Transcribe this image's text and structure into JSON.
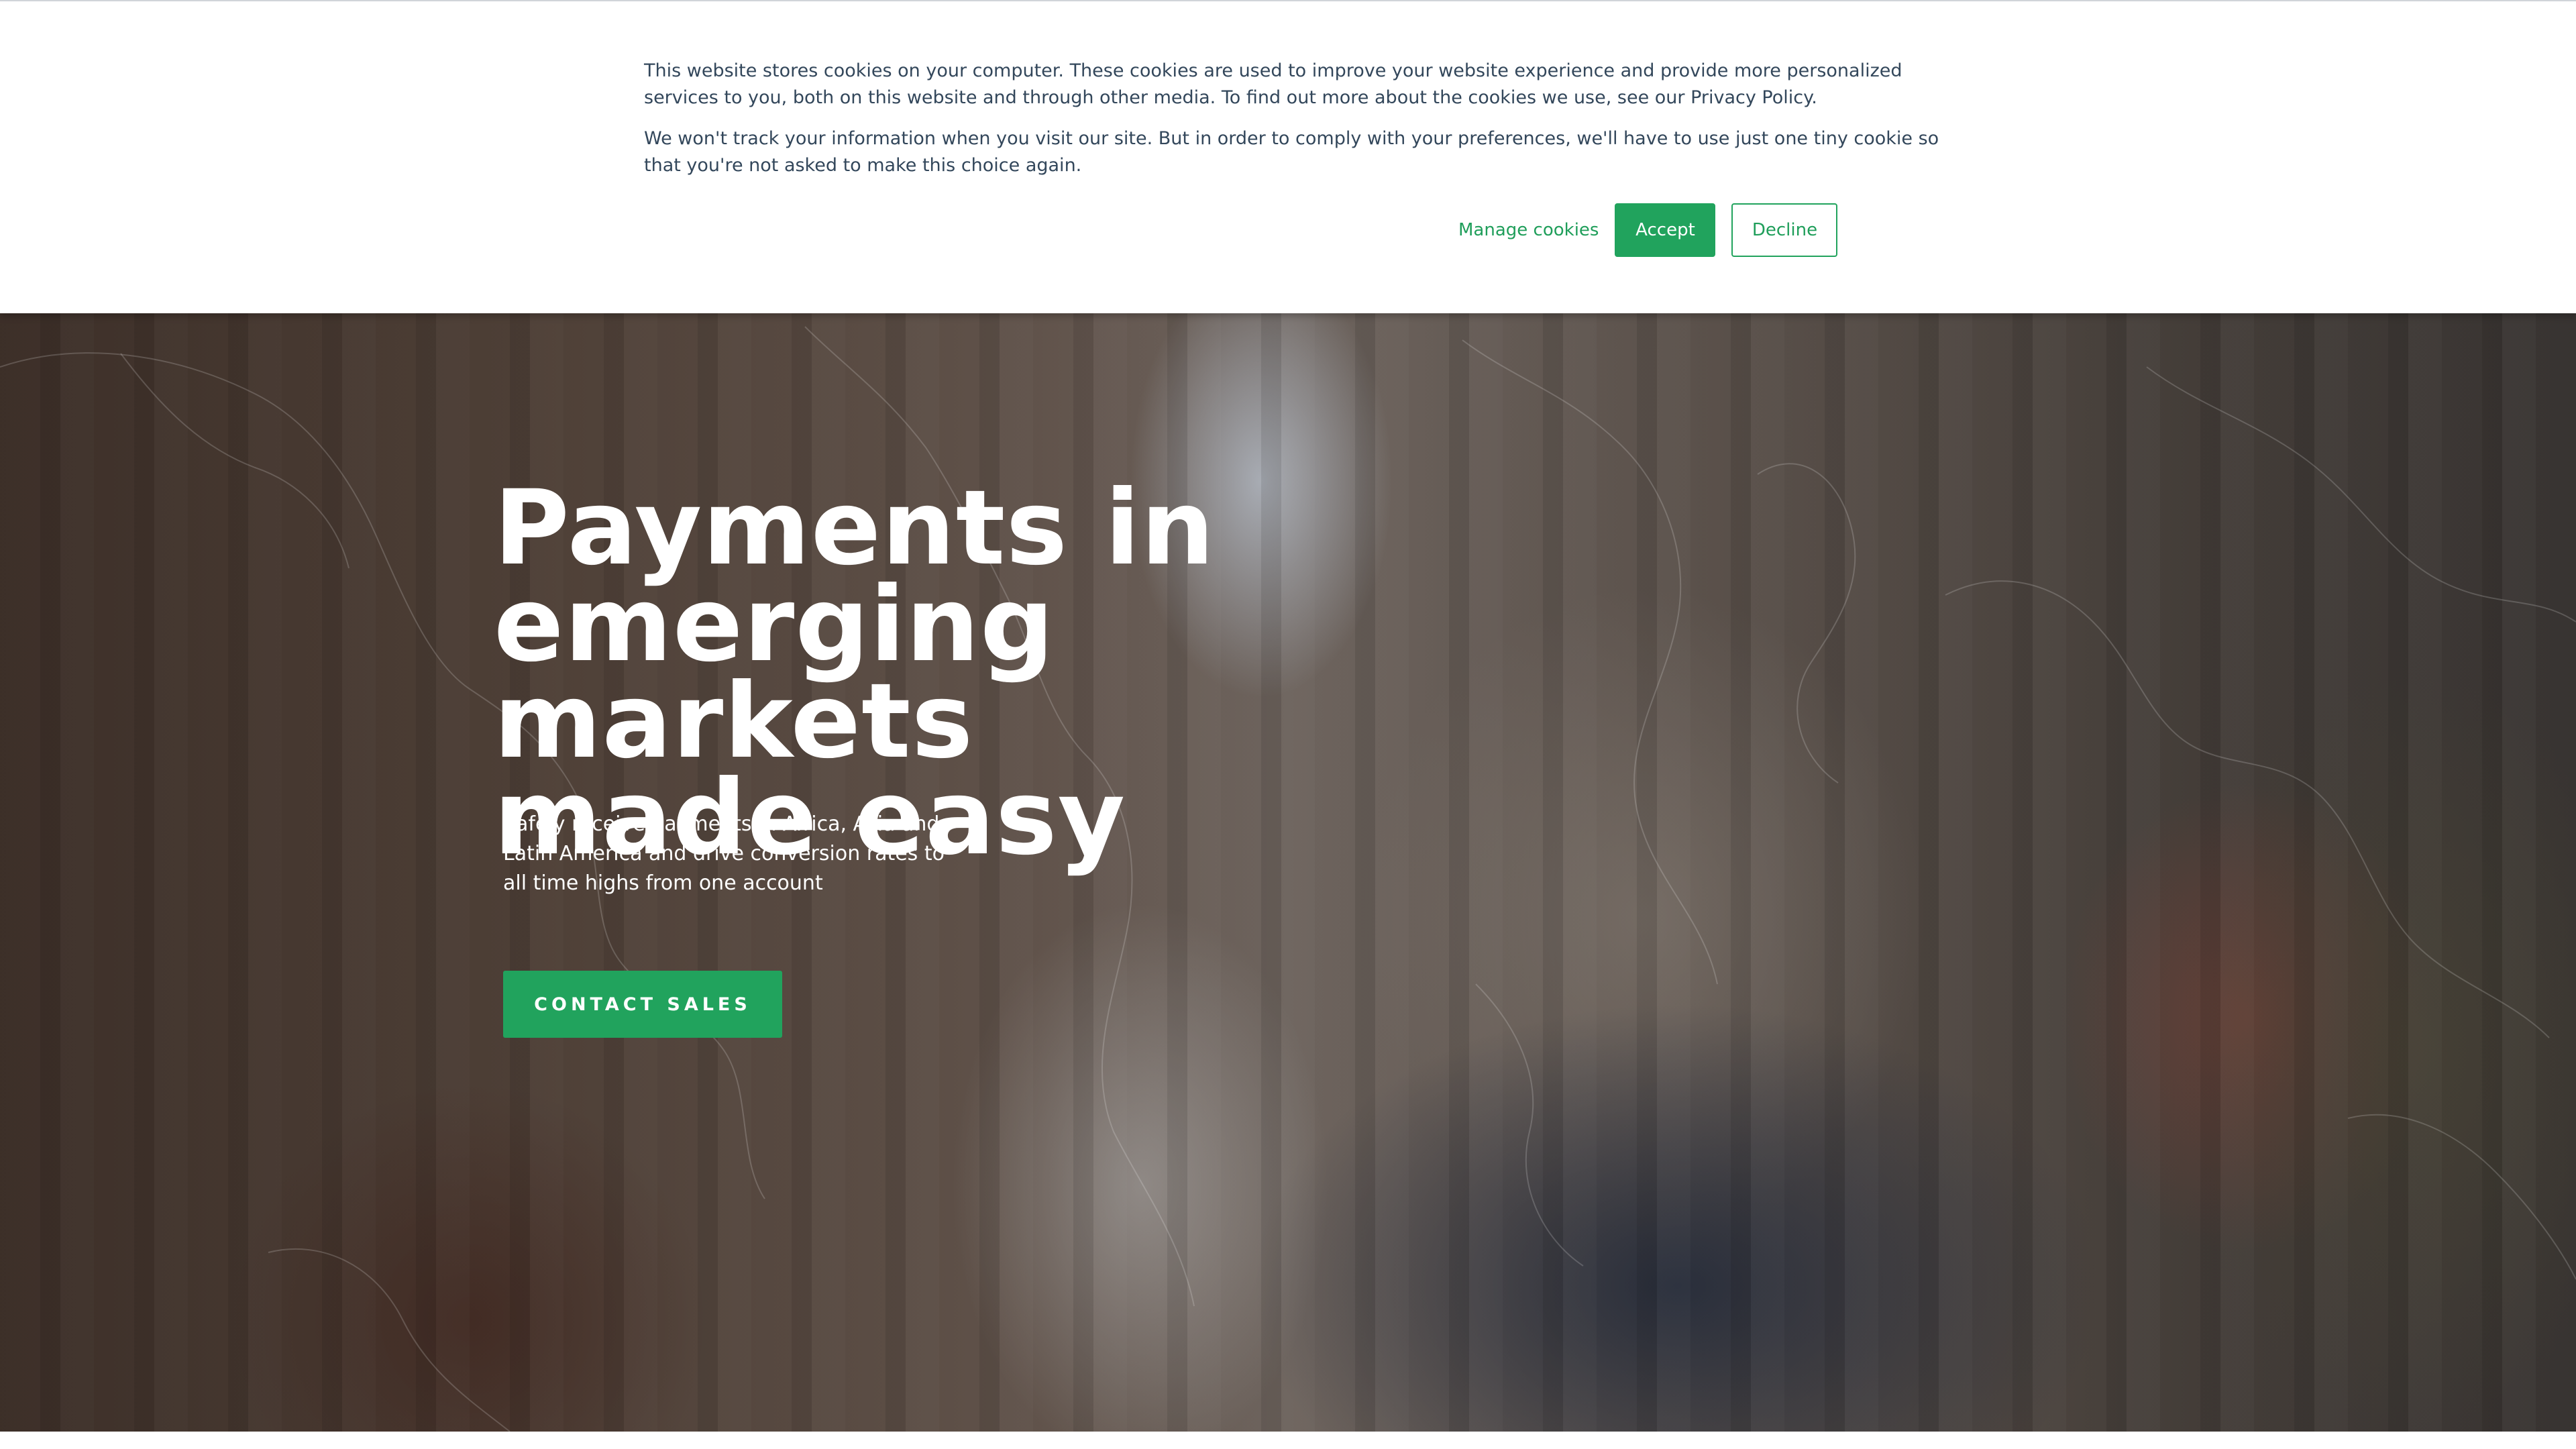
{
  "cookie_banner": {
    "paragraph_1": "This website stores cookies on your computer. These cookies are used to improve your website experience and provide more personalized services to you, both on this website and through other media. To find out more about the cookies we use, see our Privacy Policy.",
    "paragraph_2": "We won't track your information when you visit our site. But in order to comply with your preferences, we'll have to use just one tiny cookie so that you're not asked to make this choice again.",
    "manage_label": "Manage cookies",
    "accept_label": "Accept",
    "decline_label": "Decline"
  },
  "hero": {
    "title_line_1": "Payments in",
    "title_line_2": "emerging markets",
    "title_line_3": "made easy",
    "subtitle": "Safely receive payments in Africa, Asia and Latin America and drive conversion rates to all time highs from one account",
    "cta_label": "CONTACT SALES"
  },
  "colors": {
    "accent": "#21a35d",
    "accent_text": "#1f9e5a",
    "body_text": "#33475b",
    "hero_text": "#ffffff"
  },
  "icons": {
    "background": "world-map-outline"
  }
}
